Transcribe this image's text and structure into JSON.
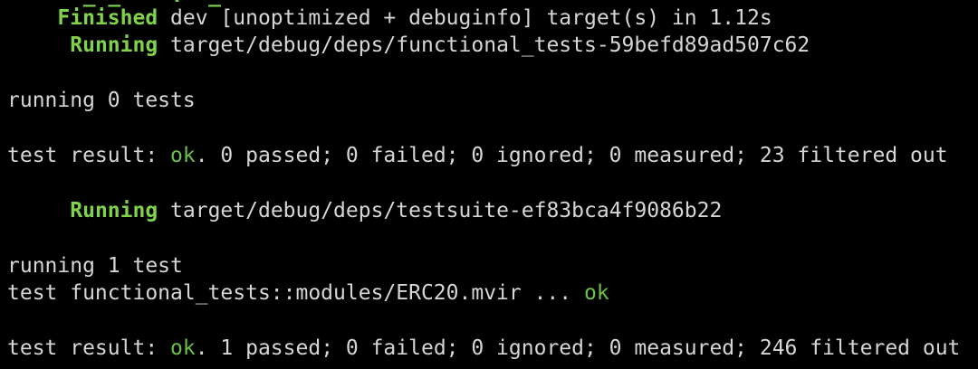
{
  "colors": {
    "background": "#000000",
    "text": "#d6d6d6",
    "status_green": "#7fd24a",
    "ok_green": "#6cc04a"
  },
  "lines": {
    "finished": {
      "keyword": "Finished",
      "rest": "dev [unoptimized + debuginfo] target(s) in 1.12s"
    },
    "running_functional": {
      "keyword": "Running",
      "rest": "target/debug/deps/functional_tests-59befd89ad507c62"
    },
    "running_zero": "running 0 tests",
    "result_zero": {
      "prefix": "test result: ",
      "status": "ok",
      "rest": ". 0 passed; 0 failed; 0 ignored; 0 measured; 23 filtered out"
    },
    "running_testsuite": {
      "keyword": "Running",
      "rest": "target/debug/deps/testsuite-ef83bca4f9086b22"
    },
    "running_one": "running 1 test",
    "test_erc20": {
      "name": "test functional_tests::modules/ERC20.mvir ... ",
      "status": "ok"
    },
    "result_one": {
      "prefix": "test result: ",
      "status": "ok",
      "rest": ". 1 passed; 0 failed; 0 ignored; 0 measured; 246 filtered out"
    }
  }
}
